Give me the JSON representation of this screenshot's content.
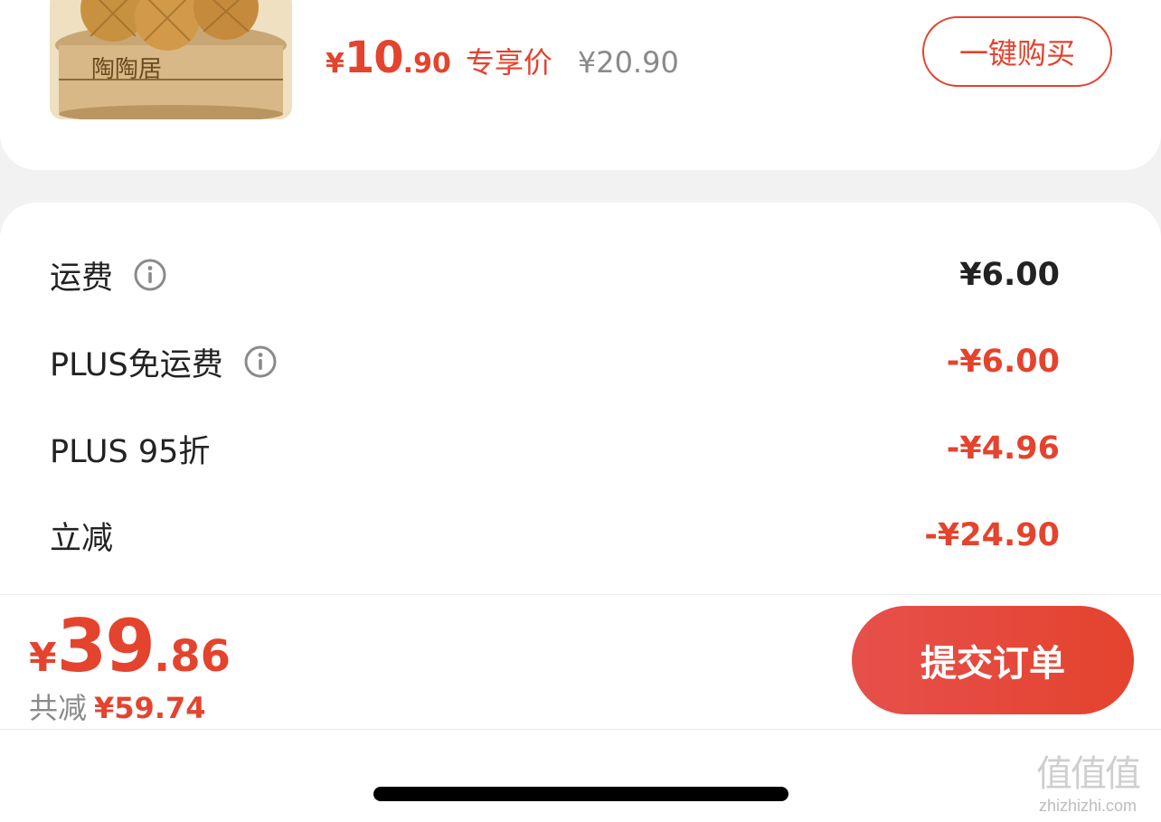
{
  "product": {
    "image_text": "陶陶居",
    "price_currency": "¥",
    "price_integer": "10",
    "price_decimal": ".90",
    "price_tag": "专享价",
    "original_price": "¥20.90",
    "buy_button_label": "一键购买"
  },
  "fees": {
    "rows": [
      {
        "label": "运费",
        "value": "¥6.00",
        "has_info": true,
        "color": "#222222"
      },
      {
        "label": "PLUS免运费",
        "value": "-¥6.00",
        "has_info": true,
        "color": "#e4432e"
      },
      {
        "label": "PLUS 95折",
        "value": "-¥4.96",
        "has_info": false,
        "color": "#e4432e"
      },
      {
        "label": "立减",
        "value": "-¥24.90",
        "has_info": false,
        "color": "#e4432e"
      }
    ]
  },
  "checkout": {
    "currency": "¥",
    "total_integer": "39",
    "total_decimal": ".86",
    "saved_label": "共减",
    "saved_value": "¥59.74",
    "submit_label": "提交订单"
  },
  "watermark": {
    "glyphs": "值值值",
    "url": "zhizhizhi.com"
  },
  "colors": {
    "accent": "#e4432e",
    "background": "#f2f2f2"
  }
}
